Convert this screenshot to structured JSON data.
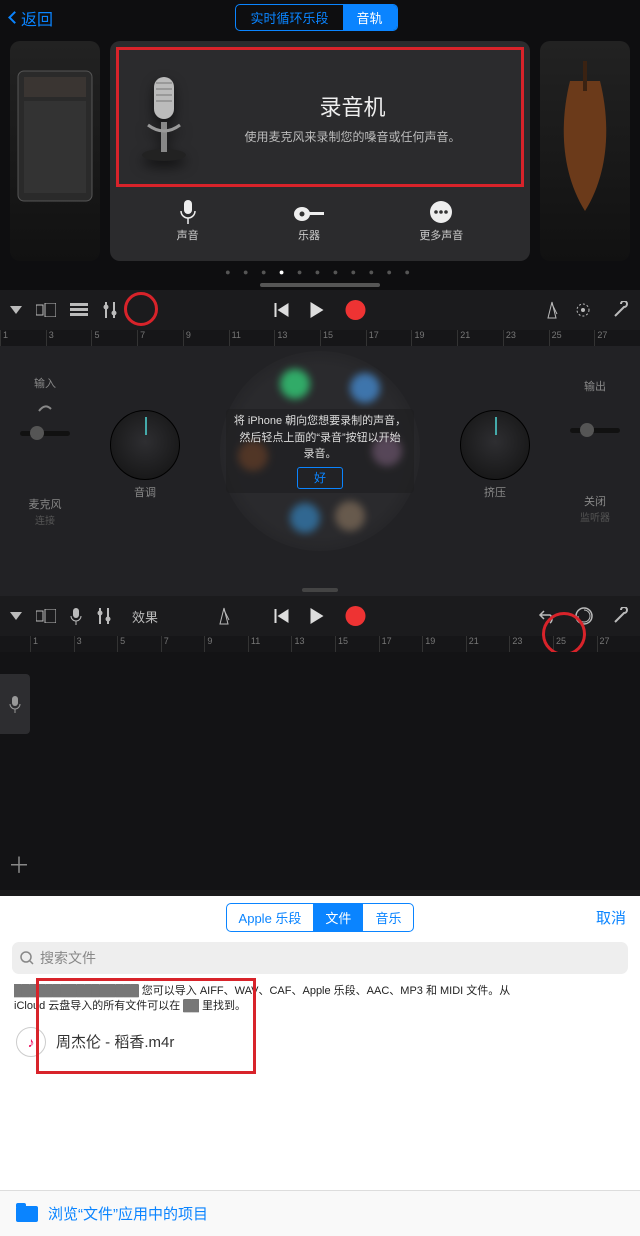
{
  "nav": {
    "back": "返回",
    "seg_live": "实时循环乐段",
    "seg_tracks": "音轨"
  },
  "hero": {
    "title": "录音机",
    "subtitle": "使用麦克风来录制您的嗓音或任何声音。"
  },
  "opts": {
    "voice": "声音",
    "instrument": "乐器",
    "more": "更多声音"
  },
  "ruler": [
    "1",
    "3",
    "5",
    "7",
    "9",
    "11",
    "13",
    "15",
    "17",
    "19",
    "21",
    "23",
    "25",
    "27"
  ],
  "p2": {
    "in": "输入",
    "out": "输出",
    "mic": "麦克风",
    "mic_sub": "连接",
    "pitch": "音调",
    "squeeze": "挤压",
    "off": "关闭",
    "off_sub": "监听器",
    "tip1": "将 iPhone 朝向您想要录制的声音，",
    "tip2": "然后轻点上面的“录音”按钮以开始",
    "tip3": "录音。",
    "ok": "好"
  },
  "p3": {
    "fx": "效果"
  },
  "p4": {
    "seg_apple": "Apple 乐段",
    "seg_file": "文件",
    "seg_music": "音乐",
    "cancel": "取消",
    "search_ph": "搜索文件",
    "hint_a": "iCloud 云盘导入的所有文件可以在",
    "hint_b": "您可以导入 AIFF、WAV、CAF、Apple 乐段、AAC、MP3 和 MIDI 文件。从",
    "hint_c": "里找到。",
    "file_name": "周杰伦 - 稻香.m4r",
    "browse": "浏览“文件”应用中的项目"
  }
}
